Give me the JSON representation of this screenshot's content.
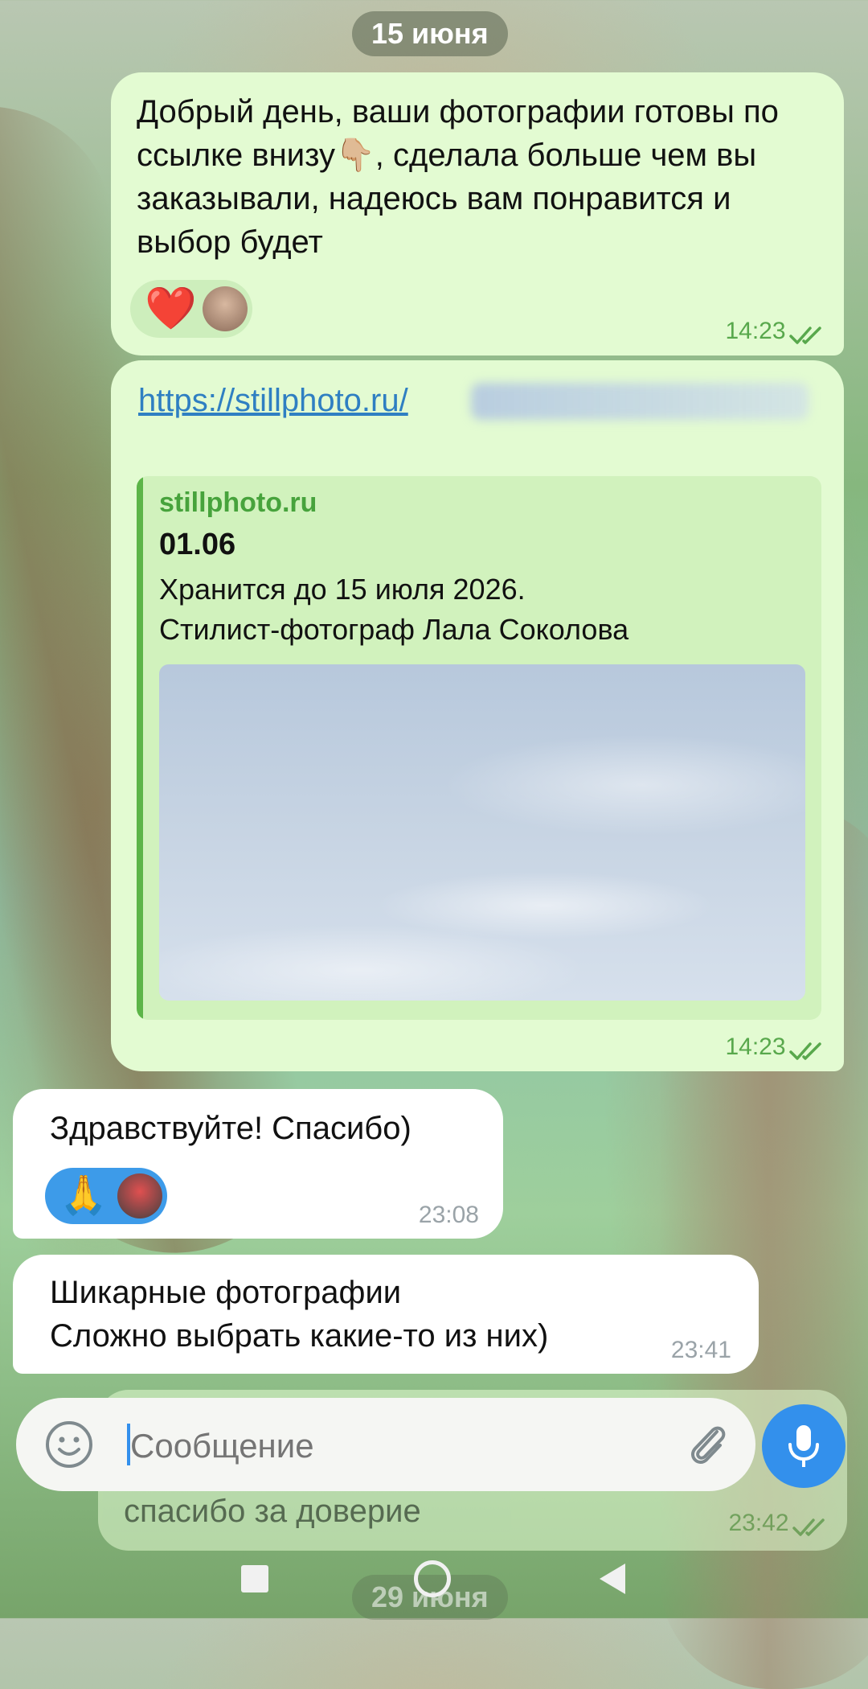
{
  "date_header": "15 июня",
  "date_header_next": "29 июня",
  "messages": {
    "m1": {
      "text": "Добрый день, ваши фотографии готовы по ссылке внизу👇🏼, сделала больше чем вы заказывали, надеюсь вам понравится и выбор будет",
      "reaction_emoji": "❤️",
      "time": "14:23"
    },
    "m2": {
      "link_text": "https://stillphoto.ru/",
      "preview_site": "stillphoto.ru",
      "preview_title": "01.06",
      "preview_desc_line1": "Хранится до 15 июля 2026.",
      "preview_desc_line2": "Стилист-фотограф Лала Соколова",
      "time": "14:23"
    },
    "m3": {
      "text": "Здравствуйте! Спасибо)",
      "reaction_emoji": "🙏",
      "time": "23:08"
    },
    "m4": {
      "line1": "Шикарные фотографии",
      "line2": "Сложно выбрать какие-то из них)",
      "time": "23:41"
    },
    "m5": {
      "text": "спасибо за доверие",
      "time": "23:42"
    }
  },
  "input": {
    "placeholder": "Сообщение"
  },
  "colors": {
    "outgoing_bubble": "#e3fbd2",
    "incoming_bubble": "#ffffff",
    "accent_blue": "#3390ec",
    "link_blue": "#2f7fc2",
    "time_green": "#58a84c"
  },
  "icons": [
    "emoji-icon",
    "attach-icon",
    "mic-icon",
    "double-check-icon",
    "nav-recents-icon",
    "nav-home-icon",
    "nav-back-icon"
  ]
}
